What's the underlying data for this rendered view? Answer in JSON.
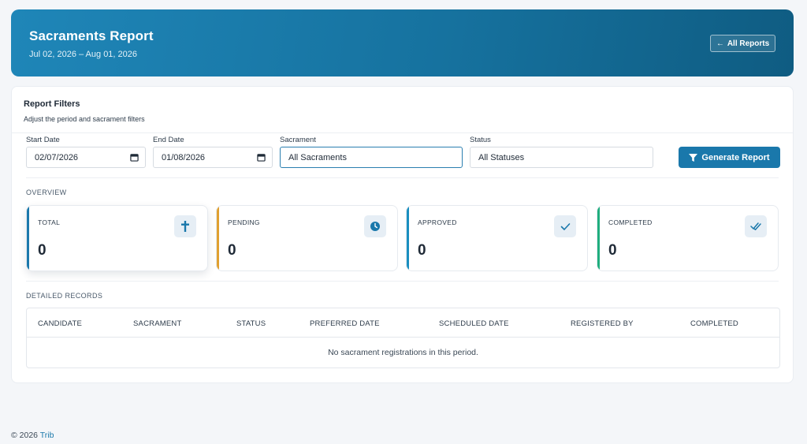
{
  "header": {
    "title": "Sacraments Report",
    "subtitle": "Jul 02, 2026 – Aug 01, 2026",
    "back_button": "All Reports"
  },
  "filters": {
    "title": "Report Filters",
    "description": "Adjust the period and sacrament filters",
    "start_date": {
      "label": "Start Date",
      "value": "02/07/2026"
    },
    "end_date": {
      "label": "End Date",
      "value": "01/08/2026"
    },
    "sacrament": {
      "label": "Sacrament",
      "value": "All Sacraments"
    },
    "status": {
      "label": "Status",
      "value": "All Statuses"
    },
    "generate_button": "Generate Report"
  },
  "overview": {
    "label": "OVERVIEW",
    "stats": [
      {
        "label": "TOTAL",
        "value": "0",
        "icon": "cross-icon",
        "color": "#1a78ab"
      },
      {
        "label": "PENDING",
        "value": "0",
        "icon": "clock-icon",
        "color": "#e0a030"
      },
      {
        "label": "APPROVED",
        "value": "0",
        "icon": "check-icon",
        "color": "#1a8fc0"
      },
      {
        "label": "COMPLETED",
        "value": "0",
        "icon": "double-check-icon",
        "color": "#1fae7e"
      }
    ]
  },
  "records": {
    "label": "DETAILED RECORDS",
    "columns": [
      "CANDIDATE",
      "SACRAMENT",
      "STATUS",
      "PREFERRED DATE",
      "SCHEDULED DATE",
      "REGISTERED BY",
      "COMPLETED"
    ],
    "empty_message": "No sacrament registrations in this period."
  },
  "footer": {
    "copyright": "© 2026",
    "brand": "Trib"
  },
  "colors": {
    "accent": "#1a78ab",
    "header_start": "#1f86b8",
    "header_end": "#0f5c82"
  }
}
